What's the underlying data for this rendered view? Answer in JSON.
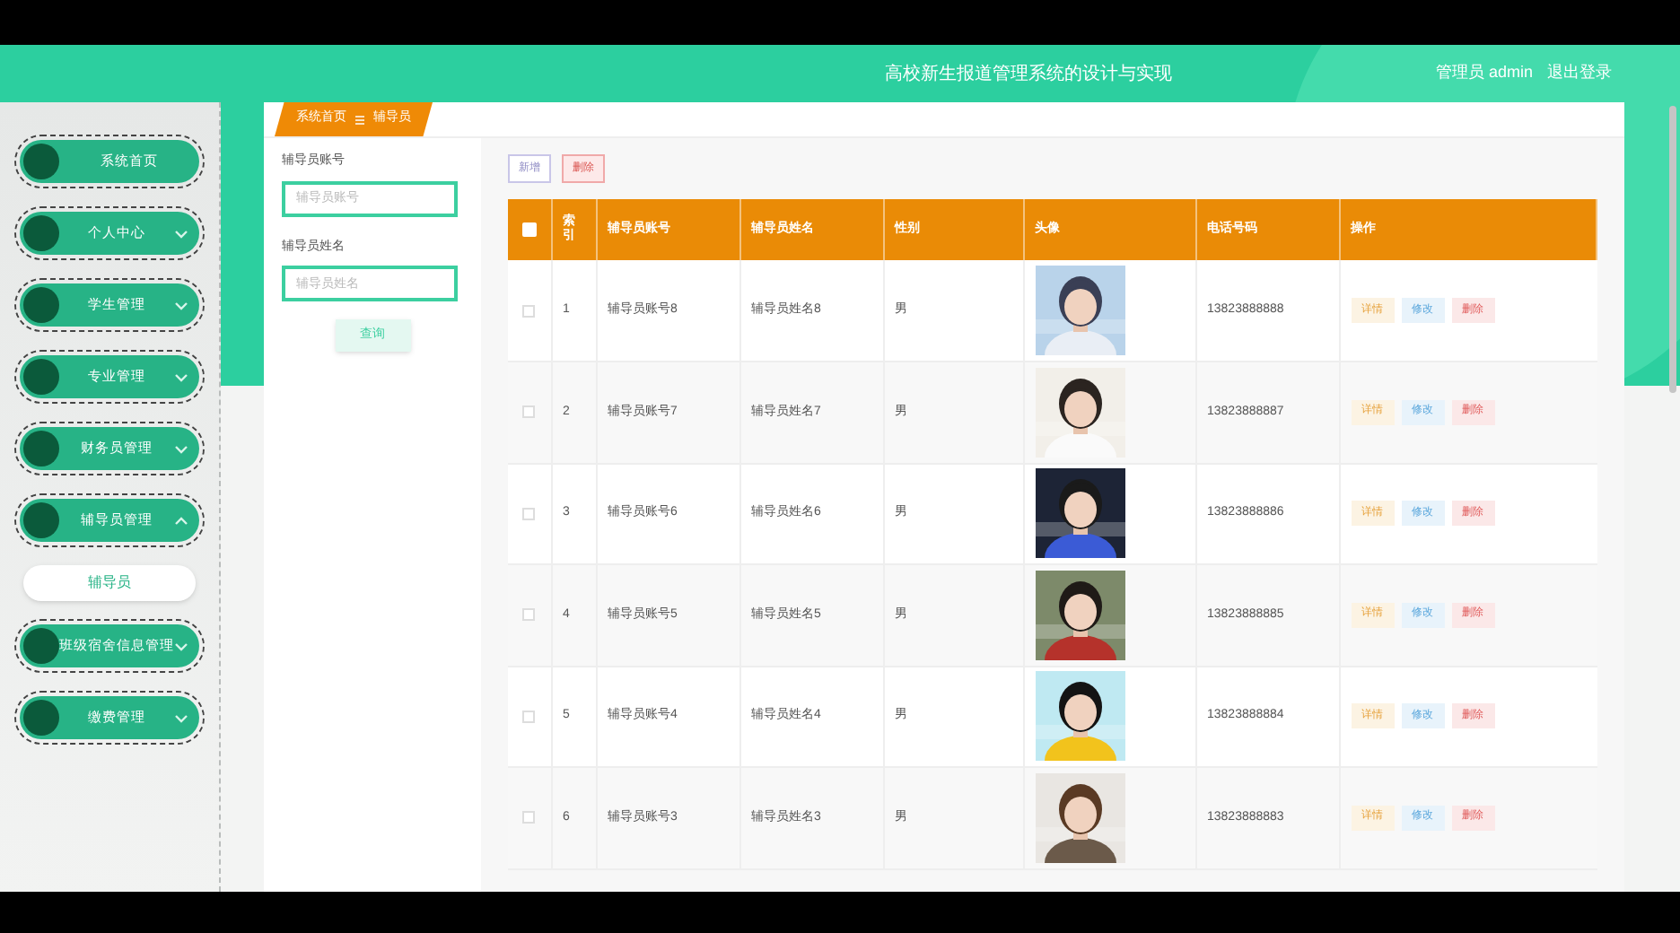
{
  "header": {
    "title": "高校新生报道管理系统的设计与实现",
    "user": "管理员 admin",
    "logout": "退出登录"
  },
  "sidebar": {
    "items": [
      {
        "label": "系统首页",
        "kind": "link"
      },
      {
        "label": "个人中心",
        "kind": "menu",
        "expanded": false
      },
      {
        "label": "学生管理",
        "kind": "menu",
        "expanded": false
      },
      {
        "label": "专业管理",
        "kind": "menu",
        "expanded": false
      },
      {
        "label": "财务员管理",
        "kind": "menu",
        "expanded": false
      },
      {
        "label": "辅导员管理",
        "kind": "menu",
        "expanded": true,
        "children": [
          {
            "label": "辅导员",
            "selected": true
          }
        ]
      },
      {
        "label": "班级宿舍信息管理",
        "kind": "menu",
        "expanded": false
      },
      {
        "label": "缴费管理",
        "kind": "menu",
        "expanded": false
      }
    ]
  },
  "breadcrumb": [
    "系统首页",
    "辅导员"
  ],
  "search": {
    "fields": [
      {
        "label": "辅导员账号",
        "placeholder": "辅导员账号"
      },
      {
        "label": "辅导员姓名",
        "placeholder": "辅导员姓名"
      }
    ],
    "button": "查询"
  },
  "toolbar": [
    {
      "label": "新增",
      "kind": "add"
    },
    {
      "label": "删除",
      "kind": "delete"
    }
  ],
  "table": {
    "header_checked": false,
    "columns": [
      "索引",
      "辅导员账号",
      "辅导员姓名",
      "性别",
      "头像",
      "电话号码",
      "操作"
    ],
    "rows": [
      {
        "checked": false,
        "index": "1",
        "account": "辅导员账号8",
        "name": "辅导员姓名8",
        "gender": "男",
        "phone": "13823888888",
        "actions": [
          "详情",
          "修改",
          "删除"
        ]
      },
      {
        "checked": false,
        "index": "2",
        "account": "辅导员账号7",
        "name": "辅导员姓名7",
        "gender": "男",
        "phone": "13823888887",
        "actions": [
          "详情",
          "修改",
          "删除"
        ]
      },
      {
        "checked": false,
        "index": "3",
        "account": "辅导员账号6",
        "name": "辅导员姓名6",
        "gender": "男",
        "phone": "13823888886",
        "actions": [
          "详情",
          "修改",
          "删除"
        ]
      },
      {
        "checked": false,
        "index": "4",
        "account": "辅导员账号5",
        "name": "辅导员姓名5",
        "gender": "男",
        "phone": "13823888885",
        "actions": [
          "详情",
          "修改",
          "删除"
        ]
      },
      {
        "checked": false,
        "index": "5",
        "account": "辅导员账号4",
        "name": "辅导员姓名4",
        "gender": "男",
        "phone": "13823888884",
        "actions": [
          "详情",
          "修改",
          "删除"
        ]
      },
      {
        "checked": false,
        "index": "6",
        "account": "辅导员账号3",
        "name": "辅导员姓名3",
        "gender": "男",
        "phone": "13823888883",
        "actions": [
          "详情",
          "修改",
          "删除"
        ]
      }
    ]
  }
}
